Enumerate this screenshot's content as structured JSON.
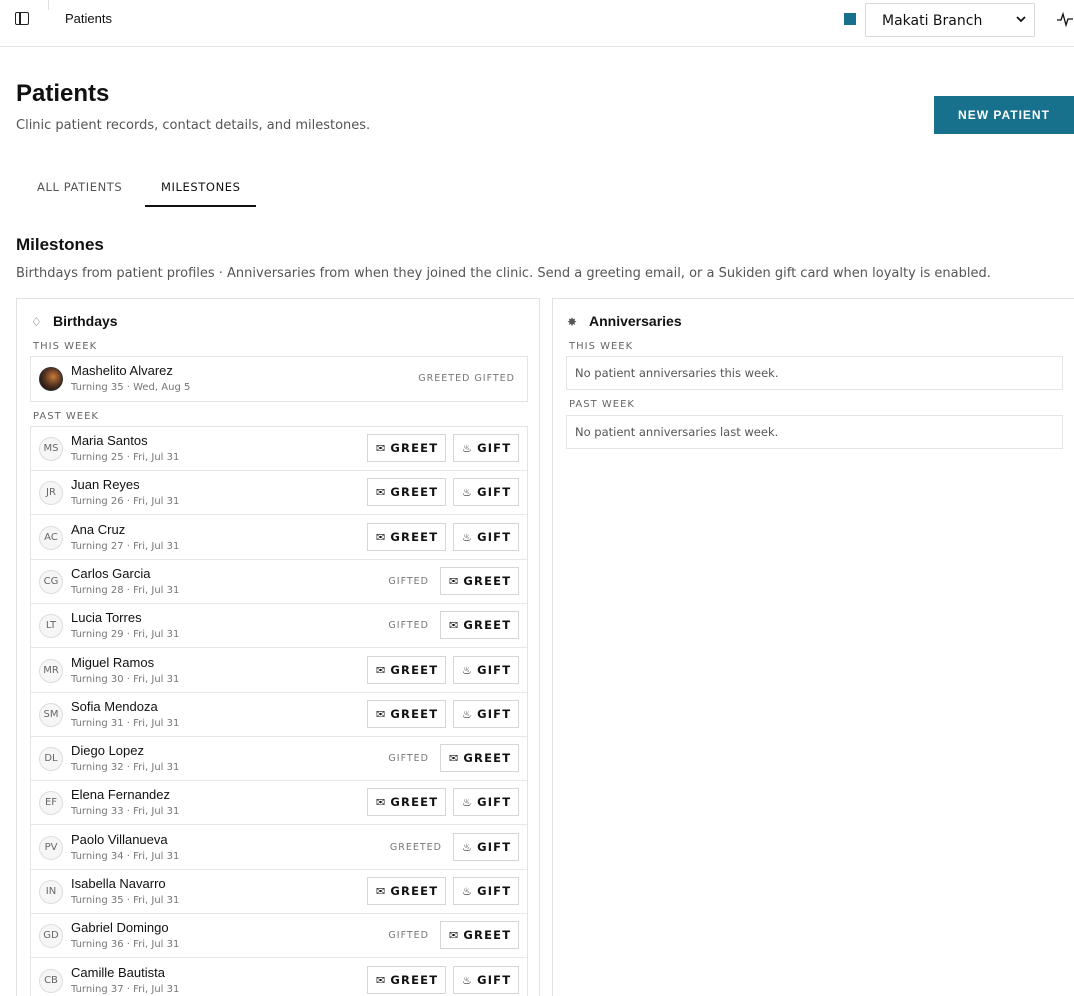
{
  "topbar": {
    "breadcrumb": "Patients",
    "branch": {
      "selected": "Makati Branch",
      "swatch_color": "#17708c"
    }
  },
  "header": {
    "title": "Patients",
    "subtitle": "Clinic patient records, contact details, and milestones.",
    "new_patient_label": "NEW PATIENT"
  },
  "tabs": [
    {
      "label": "ALL PATIENTS",
      "active": false
    },
    {
      "label": "MILESTONES",
      "active": true
    }
  ],
  "milestones": {
    "title": "Milestones",
    "subtitle": "Birthdays from patient profiles · Anniversaries from when they joined the clinic. Send a greeting email, or a Sukiden gift card when loyalty is enabled."
  },
  "birthdays": {
    "title": "Birthdays",
    "this_week_label": "THIS WEEK",
    "past_week_label": "PAST WEEK",
    "greet_label": "GREET",
    "gift_label": "GIFT",
    "this_week": [
      {
        "name": "Mashelito Alvarez",
        "meta": "Turning 35 · Wed, Aug 5",
        "status": "GREETED GIFTED",
        "photo": true
      }
    ],
    "past_week": [
      {
        "initials": "MS",
        "name": "Maria Santos",
        "meta": "Turning 25 · Fri, Jul 31",
        "status": "",
        "actions": [
          "greet",
          "gift"
        ]
      },
      {
        "initials": "JR",
        "name": "Juan Reyes",
        "meta": "Turning 26 · Fri, Jul 31",
        "status": "",
        "actions": [
          "greet",
          "gift"
        ]
      },
      {
        "initials": "AC",
        "name": "Ana Cruz",
        "meta": "Turning 27 · Fri, Jul 31",
        "status": "",
        "actions": [
          "greet",
          "gift"
        ]
      },
      {
        "initials": "CG",
        "name": "Carlos Garcia",
        "meta": "Turning 28 · Fri, Jul 31",
        "status": "GIFTED",
        "actions": [
          "greet"
        ]
      },
      {
        "initials": "LT",
        "name": "Lucia Torres",
        "meta": "Turning 29 · Fri, Jul 31",
        "status": "GIFTED",
        "actions": [
          "greet"
        ]
      },
      {
        "initials": "MR",
        "name": "Miguel Ramos",
        "meta": "Turning 30 · Fri, Jul 31",
        "status": "",
        "actions": [
          "greet",
          "gift"
        ]
      },
      {
        "initials": "SM",
        "name": "Sofia Mendoza",
        "meta": "Turning 31 · Fri, Jul 31",
        "status": "",
        "actions": [
          "greet",
          "gift"
        ]
      },
      {
        "initials": "DL",
        "name": "Diego Lopez",
        "meta": "Turning 32 · Fri, Jul 31",
        "status": "GIFTED",
        "actions": [
          "greet"
        ]
      },
      {
        "initials": "EF",
        "name": "Elena Fernandez",
        "meta": "Turning 33 · Fri, Jul 31",
        "status": "",
        "actions": [
          "greet",
          "gift"
        ]
      },
      {
        "initials": "PV",
        "name": "Paolo Villanueva",
        "meta": "Turning 34 · Fri, Jul 31",
        "status": "GREETED",
        "actions": [
          "gift"
        ]
      },
      {
        "initials": "IN",
        "name": "Isabella Navarro",
        "meta": "Turning 35 · Fri, Jul 31",
        "status": "",
        "actions": [
          "greet",
          "gift"
        ]
      },
      {
        "initials": "GD",
        "name": "Gabriel Domingo",
        "meta": "Turning 36 · Fri, Jul 31",
        "status": "GIFTED",
        "actions": [
          "greet"
        ]
      },
      {
        "initials": "CB",
        "name": "Camille Bautista",
        "meta": "Turning 37 · Fri, Jul 31",
        "status": "",
        "actions": [
          "greet",
          "gift"
        ]
      }
    ]
  },
  "anniversaries": {
    "title": "Anniversaries",
    "this_week_label": "THIS WEEK",
    "this_week_empty": "No patient anniversaries this week.",
    "past_week_label": "PAST WEEK",
    "past_week_empty": "No patient anniversaries last week."
  }
}
